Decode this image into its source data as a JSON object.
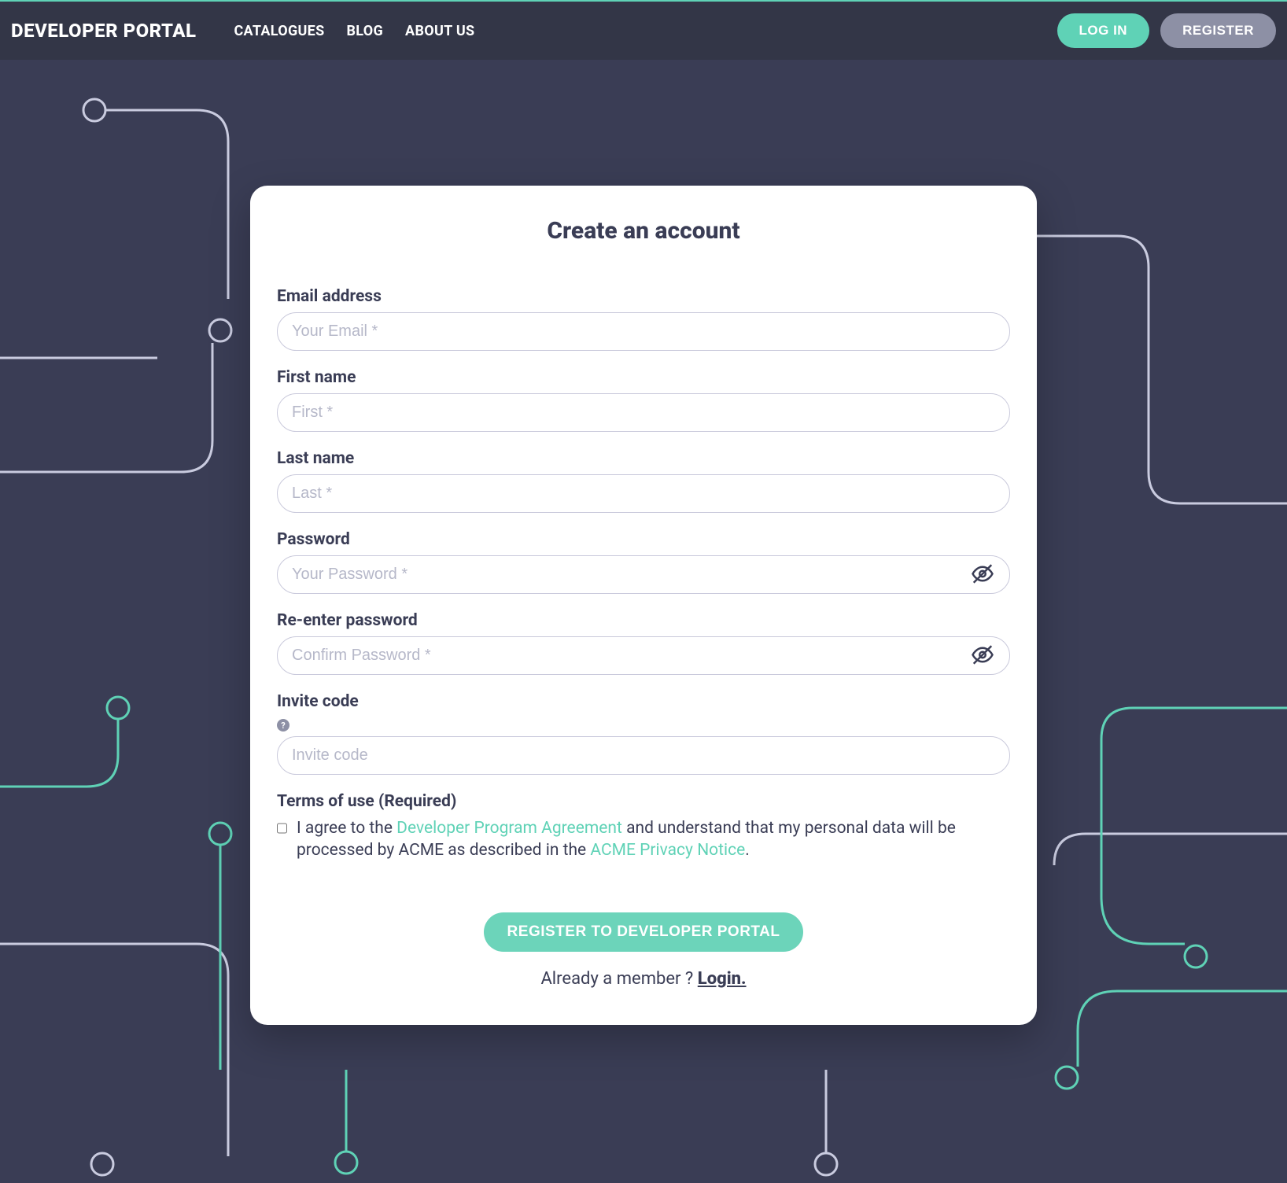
{
  "header": {
    "brand": "DEVELOPER PORTAL",
    "menu": [
      "CATALOGUES",
      "BLOG",
      "ABOUT US"
    ],
    "login": "LOG IN",
    "register": "REGISTER"
  },
  "form": {
    "title": "Create an account",
    "email": {
      "label": "Email address",
      "placeholder": "Your Email *"
    },
    "first": {
      "label": "First name",
      "placeholder": "First *"
    },
    "last": {
      "label": "Last name",
      "placeholder": "Last *"
    },
    "password": {
      "label": "Password",
      "placeholder": "Your Password *"
    },
    "confirm": {
      "label": "Re-enter password",
      "placeholder": "Confirm Password *"
    },
    "invite": {
      "label": "Invite code",
      "placeholder": "Invite code",
      "help": "?"
    },
    "terms": {
      "heading": "Terms of use (Required)",
      "prefix": "I agree to the ",
      "link1": "Developer Program Agreement",
      "middle": " and understand that my personal data will be processed by ACME as described in the ",
      "link2": "ACME Privacy Notice",
      "suffix": "."
    },
    "submit": "REGISTER TO DEVELOPER PORTAL",
    "already_prefix": "Already a member ? ",
    "already_link": "Login."
  }
}
